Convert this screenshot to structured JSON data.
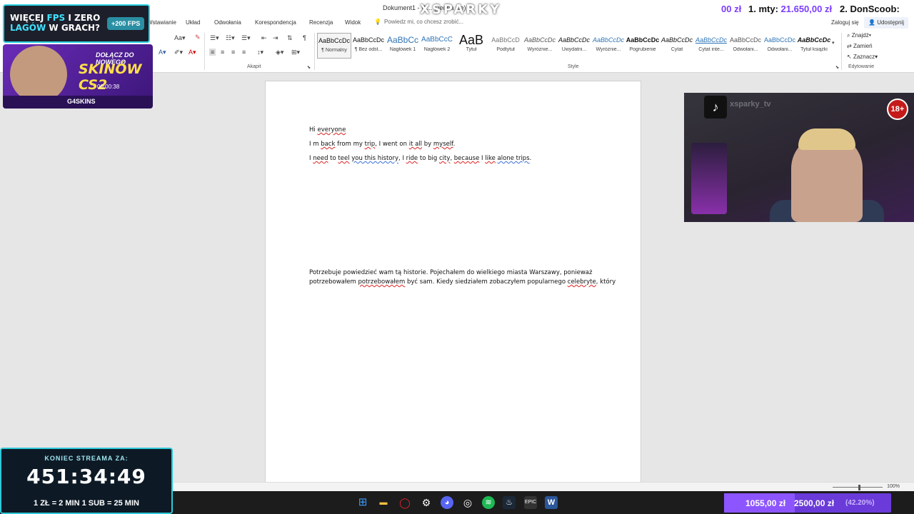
{
  "app": {
    "doc_title": "Dokument1 - W... (Jedna sie)",
    "brand": "XSPARKY"
  },
  "tabs": [
    "Wstawianie",
    "Układ",
    "Odwołania",
    "Korespondencja",
    "Recenzja",
    "Widok"
  ],
  "tell_me": "Powiedz mi, co chcesz zrobić...",
  "sign_in": "Zaloguj się",
  "share": "Udostępnij",
  "ribbon": {
    "groups": [
      "Akapit",
      "Style",
      "Edytowanie"
    ],
    "styles": [
      {
        "sample": "AaBbCcDc",
        "name": "¶ Normalny"
      },
      {
        "sample": "AaBbCcDc",
        "name": "¶ Bez odst..."
      },
      {
        "sample": "AaBbCc",
        "name": "Nagłówek 1"
      },
      {
        "sample": "AaBbCcC",
        "name": "Nagłówek 2"
      },
      {
        "sample": "AaB",
        "name": "Tytuł"
      },
      {
        "sample": "AaBbCcD",
        "name": "Podtytuł"
      },
      {
        "sample": "AaBbCcDc",
        "name": "Wyróżnie..."
      },
      {
        "sample": "AaBbCcDc",
        "name": "Uwydatni..."
      },
      {
        "sample": "AaBbCcDc",
        "name": "Wyróżnie..."
      },
      {
        "sample": "AaBbCcDc",
        "name": "Pogrubienie"
      },
      {
        "sample": "AaBbCcDc",
        "name": "Cytat"
      },
      {
        "sample": "AaBbCcDc",
        "name": "Cytat inte..."
      },
      {
        "sample": "AaBbCcDc",
        "name": "Odwołani..."
      },
      {
        "sample": "AaBbCcDc",
        "name": "Odwołani..."
      },
      {
        "sample": "AaBbCcDc",
        "name": "Tytuł książki"
      }
    ],
    "editing": [
      "Znajdź",
      "Zamień",
      "Zaznacz"
    ]
  },
  "document": {
    "lines": [
      "Hi everyone",
      "I m back from my trip, I went on it all by myself.",
      "I need to teel you this history, I ride to big city, because I like alone trips.",
      "Potrzebuje powiedzieć wam tą historie. Pojechałem do wielkiego miasta Warszawy, ponieważ",
      "potrzebowałem potrzebowałem być sam.  Kiedy siedziałem zobaczyłem popularnego celebryte, który"
    ]
  },
  "status": {
    "zoom": "100%"
  },
  "overlays": {
    "promo1": {
      "line1a": "WIĘCEJ ",
      "line1b": "FPS",
      "line1c": " I ZERO",
      "line2a": "LAGÓW",
      "line2b": " W GRACH?",
      "badge": "+200 FPS"
    },
    "promo2": {
      "line1": "DOŁĄCZ DO NOWEGO",
      "line2": "SKINÓW CS2",
      "timer": "00:00:38",
      "logo": "G4SKINS"
    },
    "ticker": [
      {
        "label": "00 zł",
        "amount": ""
      },
      {
        "label": "1. mty: ",
        "amount": "21.650,00 zł"
      },
      {
        "label": "2. DonScoob: ",
        "amount": ""
      }
    ],
    "webcam": {
      "handle": "xsparky_tv",
      "age_badge": "18+"
    },
    "countdown": {
      "label": "KONIEC STREAMA ZA:",
      "timer": "451:34:49",
      "rates": "1 ZŁ = 2 MIN   1 SUB = 25 MIN"
    },
    "goal": {
      "current": "1055,00 zł",
      "target": "2500,00 zł",
      "percent": "(42.20%)",
      "progress": 0.422
    }
  },
  "taskbar": {
    "icons": [
      "windows-start",
      "file-explorer",
      "opera",
      "steelseries",
      "discord",
      "obs",
      "spotify",
      "steam",
      "epic-games",
      "word"
    ]
  },
  "colors": {
    "accent": "#2b579a",
    "spell_error": "#d22222",
    "grammar": "#3a6fd8",
    "goal": "#8d55ff",
    "countdown_border": "#2ec9d8"
  }
}
